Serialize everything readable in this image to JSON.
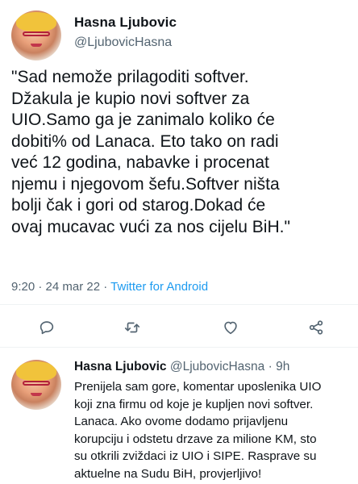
{
  "main_tweet": {
    "author_name": "Hasna Ljubovic",
    "author_handle": "@LjubovicHasna",
    "more_icon": "more-horizontal-icon",
    "text": "\"Sad nemože prilagoditi softver.\nDžakula je kupio novi softver za\nUIO.Samo ga je zanimalo koliko će\ndobiti% od Lanaca. Eto tako on radi\nveć 12 godina, nabavke i procenat\nnjemu i njegovom šefu.Softver ništa\nbolji čak i gori od starog.Dokad će\novaj mucavac vući za nos cijelu BiH.\"",
    "time": "9:20",
    "separator": " · ",
    "date": "24 mar 22",
    "source": "Twitter for Android"
  },
  "actions": {
    "reply_icon": "reply-icon",
    "retweet_icon": "retweet-icon",
    "like_icon": "heart-icon",
    "share_icon": "share-icon"
  },
  "reply_tweet": {
    "author_name": "Hasna Ljubovic",
    "author_handle": "@LjubovicHasna",
    "dot": " · ",
    "age": "9h",
    "text": "Prenijela sam gore, komentar uposlenika UIO\nkoji zna firmu od koje je kupljen novi softver.\nLanaca. Ako ovome dodamo prijavljenu\nkorupciju i odstetu drzave za milione KM, sto\nsu otkrili zviždaci iz UIO i SIPE. Rasprave su\naktuelne na Sudu BiH, provjerljivo!"
  },
  "colors": {
    "link": "#1d9bf0",
    "secondary_text": "#536471",
    "primary_text": "#0f1419",
    "divider": "#eff3f4"
  }
}
